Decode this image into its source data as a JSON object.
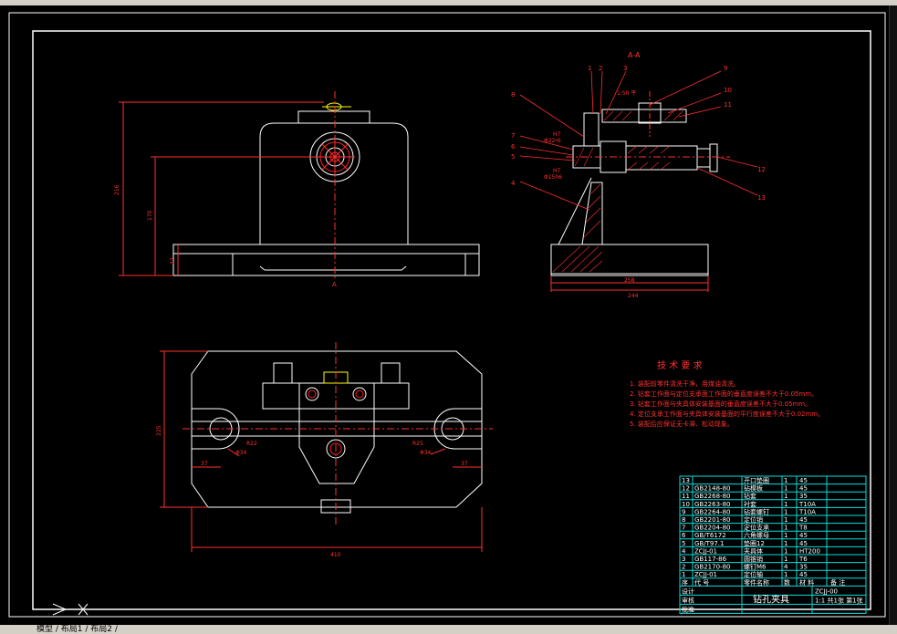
{
  "section_label": "A-A",
  "view_label_a": "A",
  "dimensions": {
    "front_height_total": "216",
    "front_height_hole": "170",
    "front_height_base": "47",
    "side_width_inner": "258",
    "side_width_outer": "244",
    "top_depth": "225",
    "top_width": "410",
    "top_slot_left": "37",
    "top_slot_right": "37",
    "r22": "R22",
    "d34_left": "Φ34",
    "r25": "R25",
    "d34_right": "Φ34",
    "fit1": "H7",
    "fit1b": "Φ22r6",
    "fit2": "H7",
    "fit2b": "Φ15h6",
    "counter_label": "1:50 平"
  },
  "balloons": [
    "1",
    "2",
    "3",
    "4",
    "5",
    "6",
    "7",
    "8",
    "9",
    "10",
    "11",
    "12",
    "13"
  ],
  "tech": {
    "title": "技 术 要 求",
    "items": [
      "1. 装配前零件清洗干净，用煤油清洗。",
      "2. 钻套工作面与定位支承面工作面的垂直度误差不大于0.05mm。",
      "3. 钻套工作面与夹具体安装基面的垂直度误差不大于0.05mm。",
      "4. 定位支承工作面与夹具体安装基面的平行度误差不大于0.02mm。",
      "5. 装配后应保证无卡滞、松动现象。"
    ]
  },
  "bom": {
    "rows": [
      {
        "no": "13",
        "code": "",
        "name": "开口垫圈",
        "qty": "1",
        "mat": "45"
      },
      {
        "no": "12",
        "code": "GB2148-80",
        "name": "钻模板",
        "qty": "1",
        "mat": "45"
      },
      {
        "no": "11",
        "code": "GB2268-80",
        "name": "钻套",
        "qty": "1",
        "mat": "35"
      },
      {
        "no": "10",
        "code": "GB2263-80",
        "name": "衬套",
        "qty": "1",
        "mat": "T10A"
      },
      {
        "no": "9",
        "code": "GB2264-80",
        "name": "钻套螺钉",
        "qty": "1",
        "mat": "T10A"
      },
      {
        "no": "8",
        "code": "GB2201-80",
        "name": "定位销",
        "qty": "1",
        "mat": "45"
      },
      {
        "no": "7",
        "code": "GB2204-80",
        "name": "定位支承",
        "qty": "1",
        "mat": "T8"
      },
      {
        "no": "6",
        "code": "GB/T6172",
        "name": "六角螺母",
        "qty": "1",
        "mat": "45"
      },
      {
        "no": "5",
        "code": "GB/T97.1",
        "name": "垫圈12",
        "qty": "1",
        "mat": "45"
      },
      {
        "no": "4",
        "code": "ZCJJ-01",
        "name": "夹具体",
        "qty": "1",
        "mat": "HT200"
      },
      {
        "no": "3",
        "code": "GB117-86",
        "name": "圆锥销",
        "qty": "1",
        "mat": "T6"
      },
      {
        "no": "2",
        "code": "GB2170-80",
        "name": "螺钉M6",
        "qty": "4",
        "mat": "35"
      },
      {
        "no": "1",
        "code": "ZCJJ-01",
        "name": "定位轴",
        "qty": "1",
        "mat": "45"
      }
    ],
    "header": {
      "no": "序",
      "code": "代 号",
      "name": "零件名称",
      "qty": "数",
      "mat": "材 料",
      "note": "备 注"
    },
    "drawing_no": "ZCJJ-00",
    "title": "钻孔夹具",
    "scale": "1:1",
    "sheet": "共1张 第1张",
    "design": "设计",
    "check": "审核",
    "approve": "批准"
  },
  "status": {
    "tabs": "模型 / 布局1 / 布局2 /"
  }
}
